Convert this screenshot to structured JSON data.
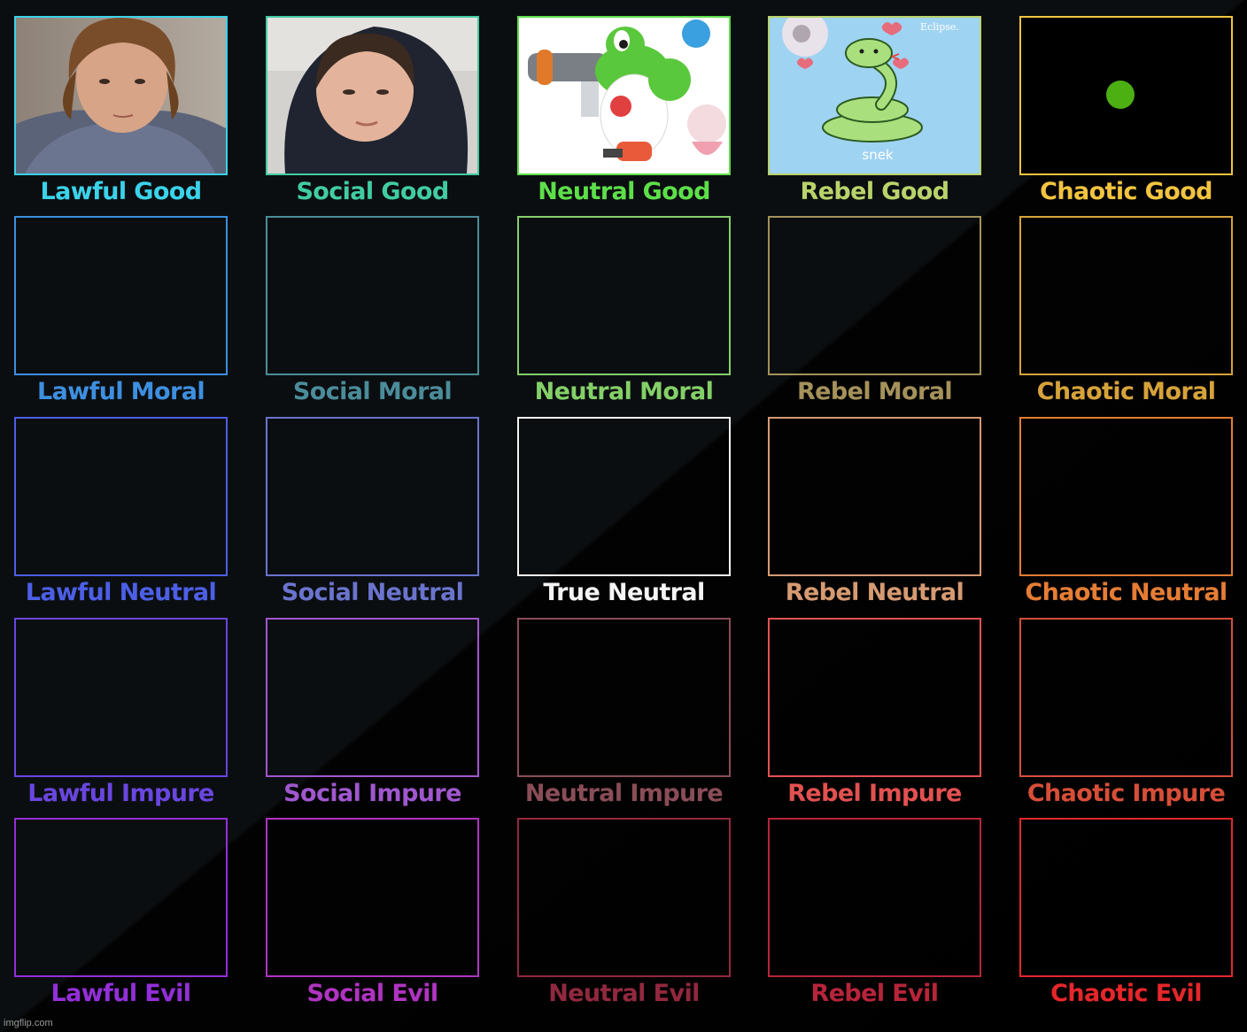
{
  "chart": {
    "columns": [
      "Lawful",
      "Social",
      "Neutral",
      "Rebel",
      "Chaotic"
    ],
    "rows": [
      "Good",
      "Moral",
      "Neutral",
      "Impure",
      "Evil"
    ],
    "cells": [
      [
        {
          "label": "Lawful Good",
          "color": "#3ad3ea",
          "image": "photo-teen-face"
        },
        {
          "label": "Social Good",
          "color": "#41cca3",
          "image": "photo-teen-hood"
        },
        {
          "label": "Neutral Good",
          "color": "#5ddf4a",
          "image": "yoshi-rabbid-art"
        },
        {
          "label": "Rebel Good",
          "color": "#b9d36b",
          "image": "snek-drawing"
        },
        {
          "label": "Chaotic Good",
          "color": "#f2c43f",
          "image": "green-dot"
        }
      ],
      [
        {
          "label": "Lawful Moral",
          "color": "#3d8fe0"
        },
        {
          "label": "Social Moral",
          "color": "#4b8c9a"
        },
        {
          "label": "Neutral Moral",
          "color": "#84d068"
        },
        {
          "label": "Rebel Moral",
          "color": "#a5925a"
        },
        {
          "label": "Chaotic Moral",
          "color": "#d6a33a"
        }
      ],
      [
        {
          "label": "Lawful Neutral",
          "color": "#4c5fe6"
        },
        {
          "label": "Social Neutral",
          "color": "#6a74cd"
        },
        {
          "label": "True Neutral",
          "color": "#f4f4f4"
        },
        {
          "label": "Rebel Neutral",
          "color": "#d69a72"
        },
        {
          "label": "Chaotic Neutral",
          "color": "#e57d34"
        }
      ],
      [
        {
          "label": "Lawful Impure",
          "color": "#6946df"
        },
        {
          "label": "Social Impure",
          "color": "#a057cf"
        },
        {
          "label": "Neutral Impure",
          "color": "#8a4d58"
        },
        {
          "label": "Rebel Impure",
          "color": "#e25150"
        },
        {
          "label": "Chaotic Impure",
          "color": "#d74e38"
        }
      ],
      [
        {
          "label": "Lawful Evil",
          "color": "#932fd9"
        },
        {
          "label": "Social Evil",
          "color": "#b033c2"
        },
        {
          "label": "Neutral Evil",
          "color": "#92283f"
        },
        {
          "label": "Rebel Evil",
          "color": "#b8243a"
        },
        {
          "label": "Chaotic Evil",
          "color": "#e6262a"
        }
      ]
    ],
    "images": {
      "snek": {
        "title": "Eclipse.",
        "caption": "snek"
      }
    }
  },
  "watermark": "imgflip.com"
}
